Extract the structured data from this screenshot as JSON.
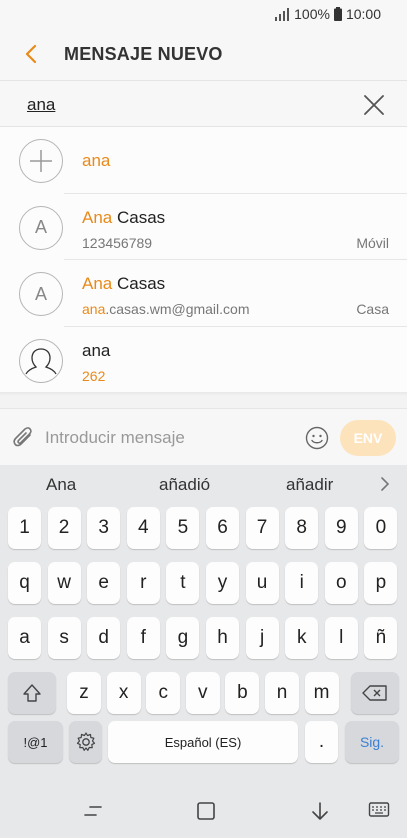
{
  "status": {
    "battery": "100%",
    "time": "10:00"
  },
  "header": {
    "title": "MENSAJE NUEVO"
  },
  "search": {
    "value": "ana"
  },
  "suggestions": [
    {
      "kind": "add",
      "name": "ana"
    },
    {
      "kind": "contact",
      "name_hl": "Ana",
      "name_rest": " Casas",
      "detail": "123456789",
      "type": "Móvil",
      "avatar": "A"
    },
    {
      "kind": "contact-email",
      "name_hl": "Ana",
      "name_rest": " Casas",
      "detail_hl": "ana",
      "detail_rest": ".casas.wm@gmail.com",
      "type": "Casa",
      "avatar": "A"
    },
    {
      "kind": "person",
      "name": "ana",
      "detail": "262"
    }
  ],
  "compose": {
    "placeholder": "Introducir mensaje",
    "send_label": "ENV"
  },
  "keyboard": {
    "predictions": [
      "Ana",
      "añadió",
      "añadir"
    ],
    "row_numbers": [
      "1",
      "2",
      "3",
      "4",
      "5",
      "6",
      "7",
      "8",
      "9",
      "0"
    ],
    "row1": [
      "q",
      "w",
      "e",
      "r",
      "t",
      "y",
      "u",
      "i",
      "o",
      "p"
    ],
    "row2": [
      "a",
      "s",
      "d",
      "f",
      "g",
      "h",
      "j",
      "k",
      "l",
      "ñ"
    ],
    "row3": [
      "z",
      "x",
      "c",
      "v",
      "b",
      "n",
      "m"
    ],
    "symbols_label": "!@1",
    "space_label": "Español (ES)",
    "period_label": ".",
    "next_label": "Sig."
  },
  "colors": {
    "accent": "#e88a1a",
    "send_bg": "#fde3bc",
    "next_key": "#3b7fd4"
  }
}
